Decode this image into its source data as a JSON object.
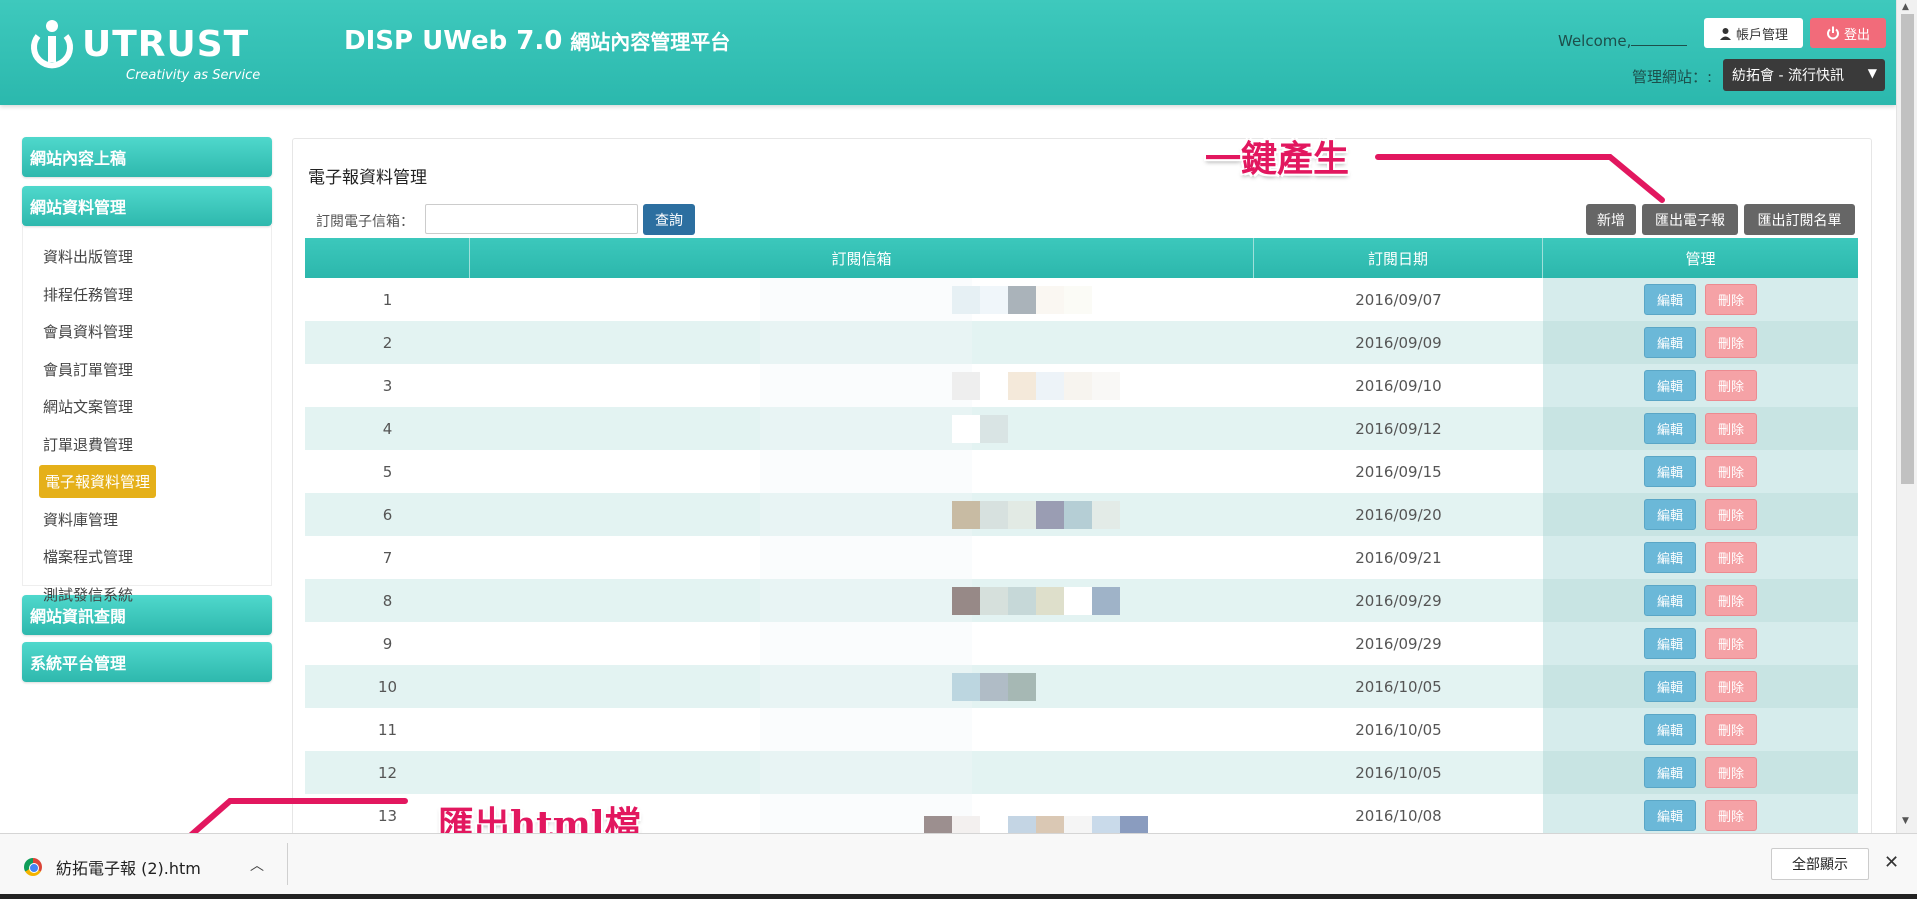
{
  "header": {
    "logo_text": "UTRUST",
    "logo_tagline": "Creativity as Service",
    "app_title": "DISP UWeb 7.0",
    "app_subtitle": "網站內容管理平台",
    "welcome": "Welcome,",
    "account_button": "帳戶管理",
    "logout_button": "登出",
    "site_label": "管理網站：:",
    "site_selected": "紡拓會 - 流行快訊"
  },
  "sidebar": {
    "sections": [
      {
        "label": "網站內容上稿"
      },
      {
        "label": "網站資料管理"
      },
      {
        "label": "網站資訊查閱"
      },
      {
        "label": "系統平台管理"
      }
    ],
    "items": [
      {
        "label": "資料出版管理"
      },
      {
        "label": "排程任務管理"
      },
      {
        "label": "會員資料管理"
      },
      {
        "label": "會員訂單管理"
      },
      {
        "label": "網站文案管理"
      },
      {
        "label": "訂單退費管理"
      },
      {
        "label": "電子報資料管理"
      },
      {
        "label": "資料庫管理"
      },
      {
        "label": "檔案程式管理"
      },
      {
        "label": "測試發信系統"
      }
    ]
  },
  "main": {
    "title": "電子報資料管理",
    "search_label": "訂閱電子信箱：",
    "search_value": "",
    "query_button": "查詢",
    "add_button": "新增",
    "export_newsletter_button": "匯出電子報",
    "export_list_button": "匯出訂閱名單",
    "table": {
      "headers": [
        "",
        "訂閱信箱",
        "訂閱日期",
        "管理"
      ],
      "edit_label": "編輯",
      "delete_label": "刪除",
      "rows": [
        {
          "no": "1",
          "date": "2016/09/07"
        },
        {
          "no": "2",
          "date": "2016/09/09"
        },
        {
          "no": "3",
          "date": "2016/09/10"
        },
        {
          "no": "4",
          "date": "2016/09/12"
        },
        {
          "no": "5",
          "date": "2016/09/15"
        },
        {
          "no": "6",
          "date": "2016/09/20"
        },
        {
          "no": "7",
          "date": "2016/09/21"
        },
        {
          "no": "8",
          "date": "2016/09/29"
        },
        {
          "no": "9",
          "date": "2016/09/29"
        },
        {
          "no": "10",
          "date": "2016/10/05"
        },
        {
          "no": "11",
          "date": "2016/10/05"
        },
        {
          "no": "12",
          "date": "2016/10/05"
        },
        {
          "no": "13",
          "date": "2016/10/08"
        }
      ]
    }
  },
  "annotations": {
    "one_click": "一鍵產生",
    "export_html": "匯出html檔"
  },
  "download_bar": {
    "filename": "紡拓電子報 (2).htm",
    "show_all": "全部顯示"
  },
  "colors": {
    "header": "#2bb8ad",
    "accent_active": "#e5b019",
    "query_button": "#2c6fa0",
    "edit_button": "#6bb8d8",
    "delete_button": "#f5a2a6",
    "annotation": "#e2175f"
  }
}
